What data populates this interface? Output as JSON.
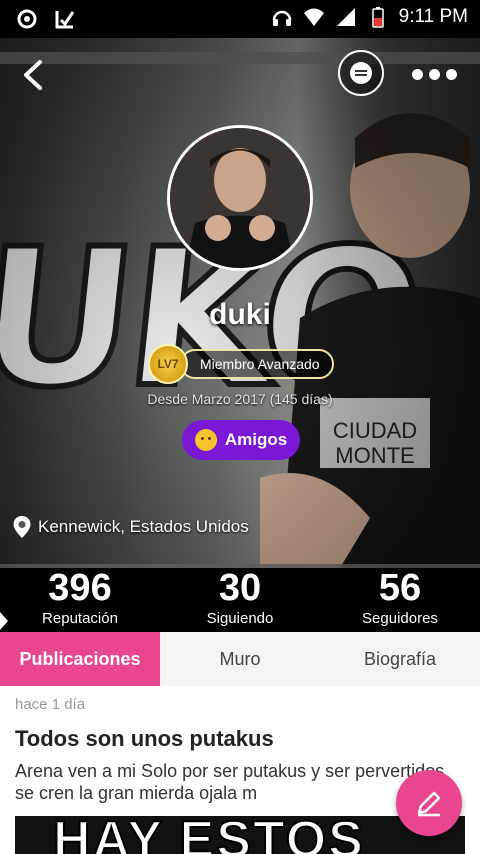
{
  "status_bar": {
    "time": "9:11 PM",
    "icons": [
      "record-icon",
      "app-notification-icon",
      "headset-icon",
      "wifi-icon",
      "signal-icon",
      "battery-icon"
    ]
  },
  "profile": {
    "username": "duki",
    "level": "LV7",
    "level_title": "Miembro Avanzado",
    "member_since": "Desde Marzo 2017 (145 días)",
    "friends_button": "Amigos",
    "location": "Kennewick, Estados Unidos",
    "cover_text": "UKO"
  },
  "stats": [
    {
      "value": "396",
      "label": "Reputación"
    },
    {
      "value": "30",
      "label": "Siguiendo"
    },
    {
      "value": "56",
      "label": "Seguidores"
    }
  ],
  "tabs": [
    {
      "label": "Publicaciones",
      "active": true
    },
    {
      "label": "Muro",
      "active": false
    },
    {
      "label": "Biografía",
      "active": false
    }
  ],
  "post": {
    "time": "hace 1 día",
    "title": "Todos son unos putakus",
    "body": "Arena ven a mi Solo por ser putakus y ser pervertidos se cren la gran mierda ojala m",
    "image_text": "HAY ESTOS"
  },
  "colors": {
    "accent": "#e9468f",
    "friends": "#7b18d8",
    "level_gold": "#f6d24a"
  }
}
